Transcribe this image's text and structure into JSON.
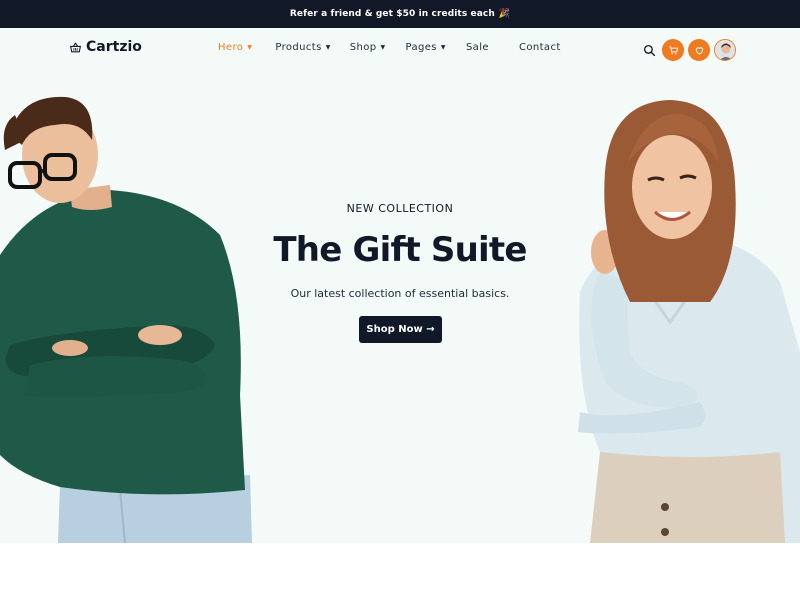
{
  "promo": {
    "text": "Refer a friend & get $50 in credits each"
  },
  "brand": {
    "name": "Cartzio"
  },
  "nav": {
    "items": [
      {
        "label": "Hero",
        "has_dropdown": true,
        "active": true
      },
      {
        "label": "Products",
        "has_dropdown": true,
        "active": false
      },
      {
        "label": "Shop",
        "has_dropdown": true,
        "active": false
      },
      {
        "label": "Pages",
        "has_dropdown": true,
        "active": false
      },
      {
        "label": "Sale",
        "has_dropdown": false,
        "active": false
      },
      {
        "label": "Contact",
        "has_dropdown": false,
        "active": false
      }
    ],
    "icons": [
      "search-icon",
      "cart-icon",
      "heart-icon",
      "user-avatar"
    ]
  },
  "hero": {
    "eyebrow": "NEW COLLECTION",
    "title": "The Gift Suite",
    "subtitle": "Our latest collection of essential basics.",
    "cta_label": "Shop Now →"
  },
  "colors": {
    "accent": "#f07a20",
    "dark": "#111827",
    "hero_bg": "#f3faf7"
  }
}
